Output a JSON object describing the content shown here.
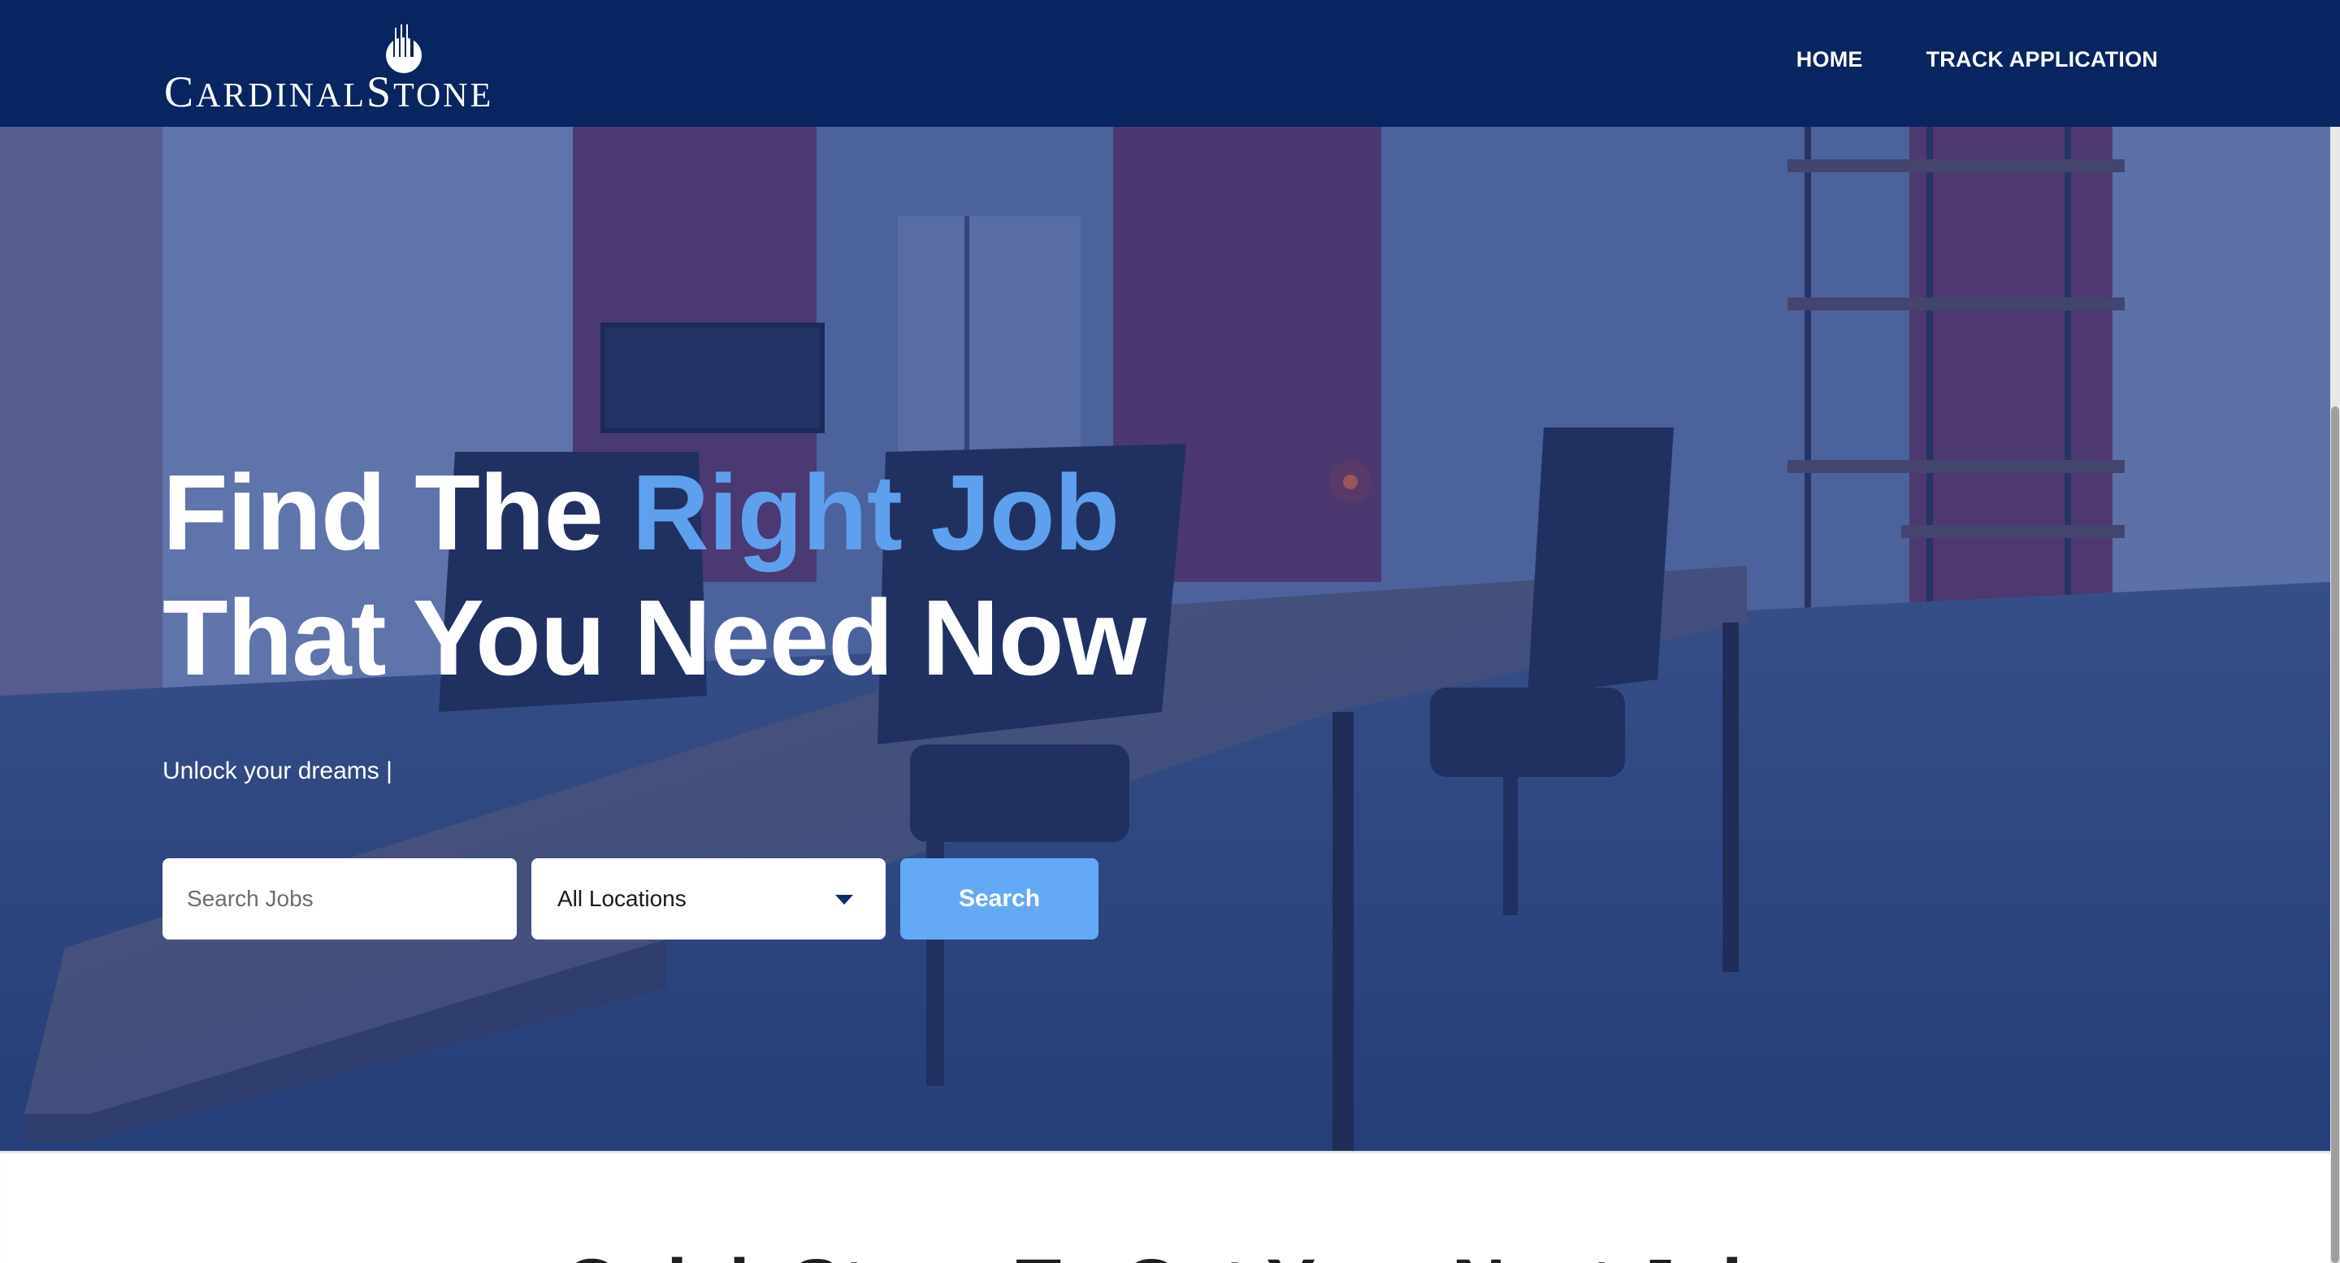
{
  "header": {
    "logo_text_first": "C",
    "logo_text_rest_1": "ARDINAL",
    "logo_text_second": "S",
    "logo_text_rest_2": "TONE",
    "nav": [
      {
        "label": "HOME"
      },
      {
        "label": "TRACK APPLICATION"
      }
    ]
  },
  "hero": {
    "title_part1": "Find The ",
    "title_accent": "Right Job",
    "title_line2": "That You Need Now",
    "subtitle": "Unlock your dreams |",
    "search": {
      "placeholder": "Search Jobs",
      "location_value": "All Locations",
      "button_label": "Search"
    }
  },
  "section": {
    "heading": "Quick Steps To Get Your Next Job"
  },
  "colors": {
    "nav_bg": "#082461",
    "accent_text": "#5ea0ee",
    "search_button": "#64a9f6"
  }
}
